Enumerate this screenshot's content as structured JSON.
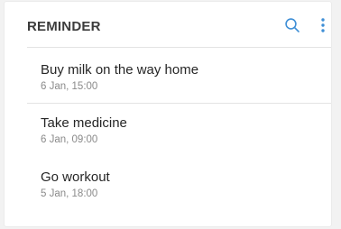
{
  "header": {
    "title": "REMINDER",
    "search_icon": "search-icon",
    "more_icon": "more-vertical-icon",
    "accent_color": "#3f8fd6"
  },
  "reminders": [
    {
      "title": "Buy milk on the way home",
      "date": "6 Jan, 15:00"
    },
    {
      "title": "Take medicine",
      "date": "6 Jan, 09:00"
    },
    {
      "title": "Go workout",
      "date": "5 Jan, 18:00"
    }
  ]
}
